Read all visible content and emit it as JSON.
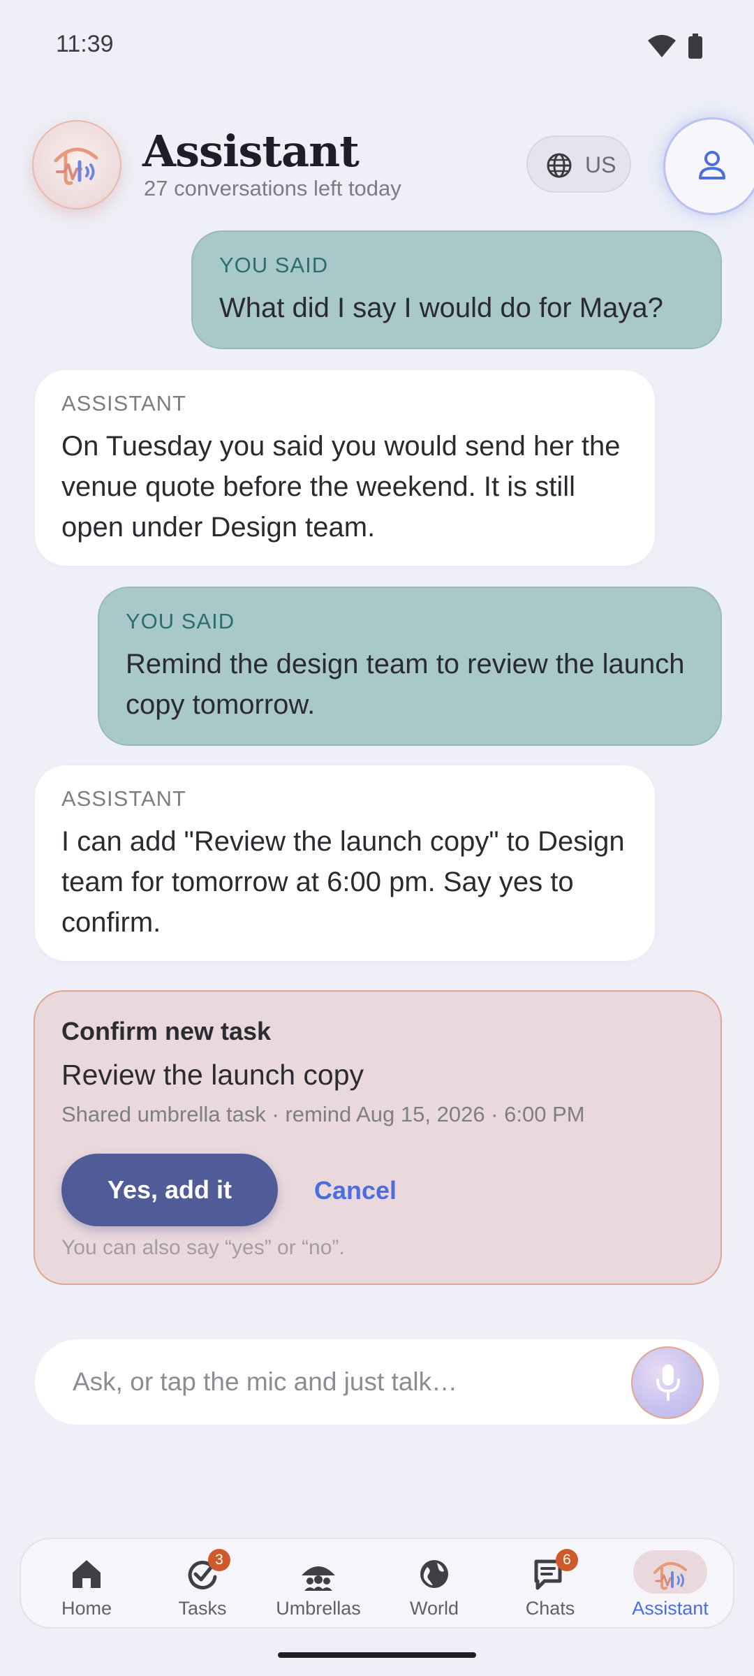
{
  "status_bar": {
    "time": "11:39"
  },
  "header": {
    "title": "Assistant",
    "subtitle": "27 conversations left today",
    "language": "US"
  },
  "conversation": [
    {
      "role": "YOU SAID",
      "text": "What did I say I would do for Maya?"
    },
    {
      "role": "ASSISTANT",
      "text": "On Tuesday you said you would send her the venue quote before the weekend. It is still open under Design team."
    },
    {
      "role": "YOU SAID",
      "text": "Remind the design team to review the launch copy tomorrow."
    },
    {
      "role": "ASSISTANT",
      "text": "I can add \"Review the launch copy\" to Design team for tomorrow at 6:00 pm. Say yes to confirm."
    }
  ],
  "confirm_card": {
    "title": "Confirm new task",
    "task_name": "Review the launch copy",
    "details": "Shared umbrella task · remind Aug 15, 2026 · 6:00 PM",
    "yes_label": "Yes, add it",
    "cancel_label": "Cancel",
    "hint": "You can also say “yes” or “no”."
  },
  "input": {
    "placeholder": "Ask, or tap the mic and just talk…"
  },
  "nav": {
    "items": [
      {
        "label": "Home"
      },
      {
        "label": "Tasks",
        "badge": "3"
      },
      {
        "label": "Umbrellas"
      },
      {
        "label": "World"
      },
      {
        "label": "Chats",
        "badge": "6"
      },
      {
        "label": "Assistant"
      }
    ],
    "active": "Assistant"
  },
  "colors": {
    "user_bubble": "#a8c8c9",
    "assistant_bubble": "#ffffff",
    "confirm_card": "#ead9dc",
    "primary_button": "#4f5c98",
    "accent": "#4a6de0",
    "badge": "#cc5a2a"
  },
  "icons": [
    "wifi-icon",
    "battery-icon",
    "umbrella-logo-icon",
    "globe-icon",
    "person-icon",
    "mic-icon",
    "home-icon",
    "tasks-icon",
    "umbrellas-icon",
    "world-icon",
    "chats-icon",
    "assistant-icon"
  ]
}
